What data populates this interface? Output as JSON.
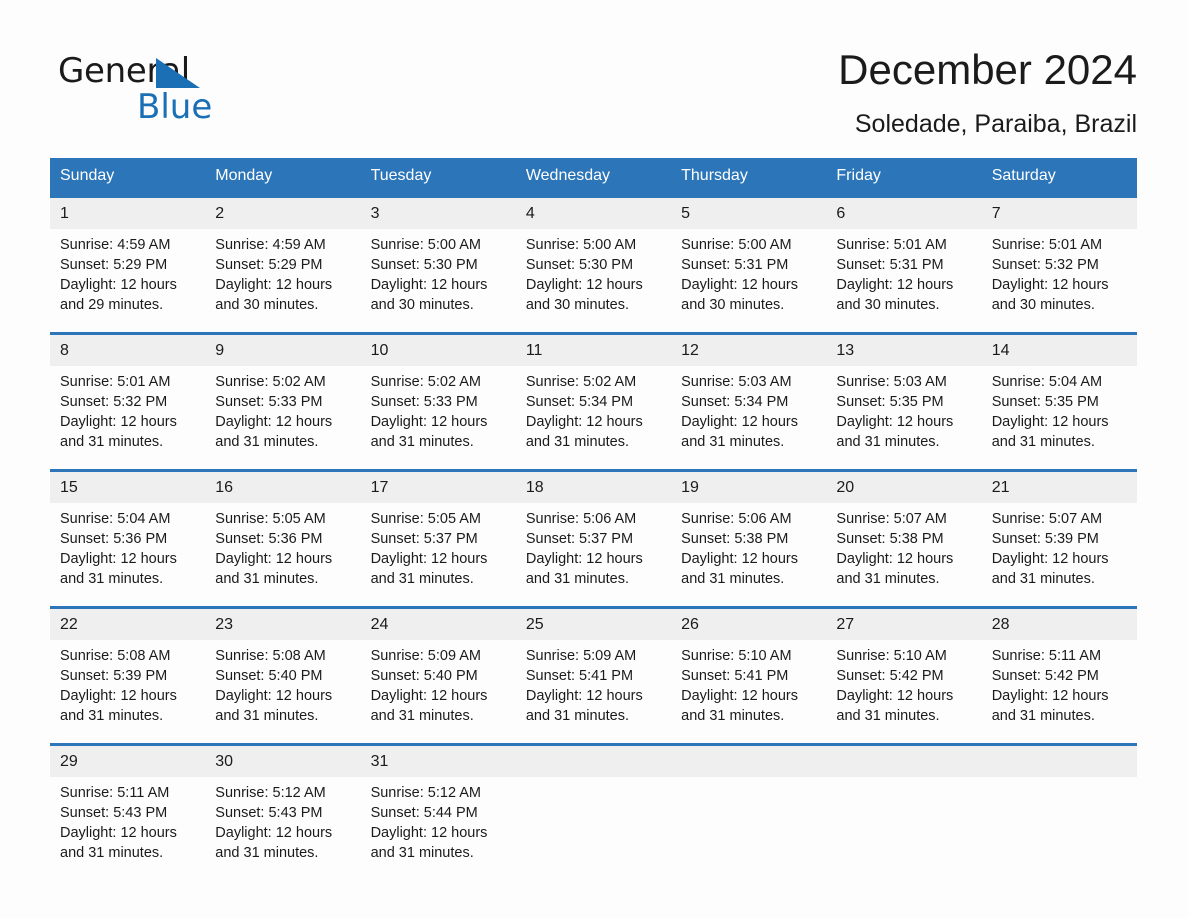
{
  "brand": {
    "name_part1": "General",
    "name_part2": "Blue",
    "accent_color": "#1a6fb5"
  },
  "header": {
    "title": "December 2024",
    "subtitle": "Soledade, Paraiba, Brazil"
  },
  "theme": {
    "header_blue": "#2b75b8",
    "daynum_band": "#efefef",
    "page_background": "#fdfdfd"
  },
  "weekday_headers": [
    "Sunday",
    "Monday",
    "Tuesday",
    "Wednesday",
    "Thursday",
    "Friday",
    "Saturday"
  ],
  "weeks": [
    [
      {
        "day": "1",
        "sunrise": "Sunrise: 4:59 AM",
        "sunset": "Sunset: 5:29 PM",
        "daylight_line1": "Daylight: 12 hours",
        "daylight_line2": "and 29 minutes."
      },
      {
        "day": "2",
        "sunrise": "Sunrise: 4:59 AM",
        "sunset": "Sunset: 5:29 PM",
        "daylight_line1": "Daylight: 12 hours",
        "daylight_line2": "and 30 minutes."
      },
      {
        "day": "3",
        "sunrise": "Sunrise: 5:00 AM",
        "sunset": "Sunset: 5:30 PM",
        "daylight_line1": "Daylight: 12 hours",
        "daylight_line2": "and 30 minutes."
      },
      {
        "day": "4",
        "sunrise": "Sunrise: 5:00 AM",
        "sunset": "Sunset: 5:30 PM",
        "daylight_line1": "Daylight: 12 hours",
        "daylight_line2": "and 30 minutes."
      },
      {
        "day": "5",
        "sunrise": "Sunrise: 5:00 AM",
        "sunset": "Sunset: 5:31 PM",
        "daylight_line1": "Daylight: 12 hours",
        "daylight_line2": "and 30 minutes."
      },
      {
        "day": "6",
        "sunrise": "Sunrise: 5:01 AM",
        "sunset": "Sunset: 5:31 PM",
        "daylight_line1": "Daylight: 12 hours",
        "daylight_line2": "and 30 minutes."
      },
      {
        "day": "7",
        "sunrise": "Sunrise: 5:01 AM",
        "sunset": "Sunset: 5:32 PM",
        "daylight_line1": "Daylight: 12 hours",
        "daylight_line2": "and 30 minutes."
      }
    ],
    [
      {
        "day": "8",
        "sunrise": "Sunrise: 5:01 AM",
        "sunset": "Sunset: 5:32 PM",
        "daylight_line1": "Daylight: 12 hours",
        "daylight_line2": "and 31 minutes."
      },
      {
        "day": "9",
        "sunrise": "Sunrise: 5:02 AM",
        "sunset": "Sunset: 5:33 PM",
        "daylight_line1": "Daylight: 12 hours",
        "daylight_line2": "and 31 minutes."
      },
      {
        "day": "10",
        "sunrise": "Sunrise: 5:02 AM",
        "sunset": "Sunset: 5:33 PM",
        "daylight_line1": "Daylight: 12 hours",
        "daylight_line2": "and 31 minutes."
      },
      {
        "day": "11",
        "sunrise": "Sunrise: 5:02 AM",
        "sunset": "Sunset: 5:34 PM",
        "daylight_line1": "Daylight: 12 hours",
        "daylight_line2": "and 31 minutes."
      },
      {
        "day": "12",
        "sunrise": "Sunrise: 5:03 AM",
        "sunset": "Sunset: 5:34 PM",
        "daylight_line1": "Daylight: 12 hours",
        "daylight_line2": "and 31 minutes."
      },
      {
        "day": "13",
        "sunrise": "Sunrise: 5:03 AM",
        "sunset": "Sunset: 5:35 PM",
        "daylight_line1": "Daylight: 12 hours",
        "daylight_line2": "and 31 minutes."
      },
      {
        "day": "14",
        "sunrise": "Sunrise: 5:04 AM",
        "sunset": "Sunset: 5:35 PM",
        "daylight_line1": "Daylight: 12 hours",
        "daylight_line2": "and 31 minutes."
      }
    ],
    [
      {
        "day": "15",
        "sunrise": "Sunrise: 5:04 AM",
        "sunset": "Sunset: 5:36 PM",
        "daylight_line1": "Daylight: 12 hours",
        "daylight_line2": "and 31 minutes."
      },
      {
        "day": "16",
        "sunrise": "Sunrise: 5:05 AM",
        "sunset": "Sunset: 5:36 PM",
        "daylight_line1": "Daylight: 12 hours",
        "daylight_line2": "and 31 minutes."
      },
      {
        "day": "17",
        "sunrise": "Sunrise: 5:05 AM",
        "sunset": "Sunset: 5:37 PM",
        "daylight_line1": "Daylight: 12 hours",
        "daylight_line2": "and 31 minutes."
      },
      {
        "day": "18",
        "sunrise": "Sunrise: 5:06 AM",
        "sunset": "Sunset: 5:37 PM",
        "daylight_line1": "Daylight: 12 hours",
        "daylight_line2": "and 31 minutes."
      },
      {
        "day": "19",
        "sunrise": "Sunrise: 5:06 AM",
        "sunset": "Sunset: 5:38 PM",
        "daylight_line1": "Daylight: 12 hours",
        "daylight_line2": "and 31 minutes."
      },
      {
        "day": "20",
        "sunrise": "Sunrise: 5:07 AM",
        "sunset": "Sunset: 5:38 PM",
        "daylight_line1": "Daylight: 12 hours",
        "daylight_line2": "and 31 minutes."
      },
      {
        "day": "21",
        "sunrise": "Sunrise: 5:07 AM",
        "sunset": "Sunset: 5:39 PM",
        "daylight_line1": "Daylight: 12 hours",
        "daylight_line2": "and 31 minutes."
      }
    ],
    [
      {
        "day": "22",
        "sunrise": "Sunrise: 5:08 AM",
        "sunset": "Sunset: 5:39 PM",
        "daylight_line1": "Daylight: 12 hours",
        "daylight_line2": "and 31 minutes."
      },
      {
        "day": "23",
        "sunrise": "Sunrise: 5:08 AM",
        "sunset": "Sunset: 5:40 PM",
        "daylight_line1": "Daylight: 12 hours",
        "daylight_line2": "and 31 minutes."
      },
      {
        "day": "24",
        "sunrise": "Sunrise: 5:09 AM",
        "sunset": "Sunset: 5:40 PM",
        "daylight_line1": "Daylight: 12 hours",
        "daylight_line2": "and 31 minutes."
      },
      {
        "day": "25",
        "sunrise": "Sunrise: 5:09 AM",
        "sunset": "Sunset: 5:41 PM",
        "daylight_line1": "Daylight: 12 hours",
        "daylight_line2": "and 31 minutes."
      },
      {
        "day": "26",
        "sunrise": "Sunrise: 5:10 AM",
        "sunset": "Sunset: 5:41 PM",
        "daylight_line1": "Daylight: 12 hours",
        "daylight_line2": "and 31 minutes."
      },
      {
        "day": "27",
        "sunrise": "Sunrise: 5:10 AM",
        "sunset": "Sunset: 5:42 PM",
        "daylight_line1": "Daylight: 12 hours",
        "daylight_line2": "and 31 minutes."
      },
      {
        "day": "28",
        "sunrise": "Sunrise: 5:11 AM",
        "sunset": "Sunset: 5:42 PM",
        "daylight_line1": "Daylight: 12 hours",
        "daylight_line2": "and 31 minutes."
      }
    ],
    [
      {
        "day": "29",
        "sunrise": "Sunrise: 5:11 AM",
        "sunset": "Sunset: 5:43 PM",
        "daylight_line1": "Daylight: 12 hours",
        "daylight_line2": "and 31 minutes."
      },
      {
        "day": "30",
        "sunrise": "Sunrise: 5:12 AM",
        "sunset": "Sunset: 5:43 PM",
        "daylight_line1": "Daylight: 12 hours",
        "daylight_line2": "and 31 minutes."
      },
      {
        "day": "31",
        "sunrise": "Sunrise: 5:12 AM",
        "sunset": "Sunset: 5:44 PM",
        "daylight_line1": "Daylight: 12 hours",
        "daylight_line2": "and 31 minutes."
      },
      {
        "day": "",
        "sunrise": "",
        "sunset": "",
        "daylight_line1": "",
        "daylight_line2": ""
      },
      {
        "day": "",
        "sunrise": "",
        "sunset": "",
        "daylight_line1": "",
        "daylight_line2": ""
      },
      {
        "day": "",
        "sunrise": "",
        "sunset": "",
        "daylight_line1": "",
        "daylight_line2": ""
      },
      {
        "day": "",
        "sunrise": "",
        "sunset": "",
        "daylight_line1": "",
        "daylight_line2": ""
      }
    ]
  ]
}
